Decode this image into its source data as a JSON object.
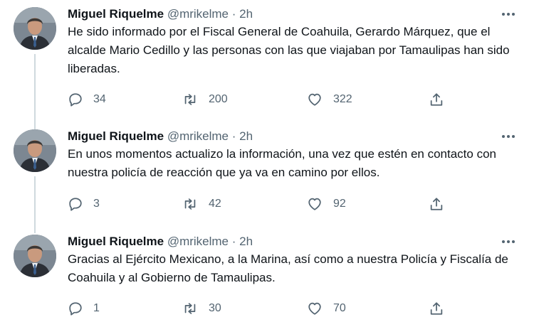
{
  "tweets": [
    {
      "name": "Miguel Riquelme",
      "handle": "@mrikelme",
      "separator": "·",
      "time": "2h",
      "text": "He sido informado por el Fiscal General de Coahuila, Gerardo Márquez, que el alcalde Mario Cedillo y las personas con las que viajaban por Tamaulipas han sido liberadas.",
      "replies": "34",
      "retweets": "200",
      "likes": "322"
    },
    {
      "name": "Miguel Riquelme",
      "handle": "@mrikelme",
      "separator": "·",
      "time": "2h",
      "text": "En unos momentos actualizo la información, una vez que estén en contacto con nuestra policía de reacción que ya va en camino por ellos.",
      "replies": "3",
      "retweets": "42",
      "likes": "92"
    },
    {
      "name": "Miguel Riquelme",
      "handle": "@mrikelme",
      "separator": "·",
      "time": "2h",
      "text": "Gracias al Ejército Mexicano, a la Marina, así como a nuestra Policía y Fiscalía de Coahuila y al Gobierno de Tamaulipas.",
      "replies": "1",
      "retweets": "30",
      "likes": "70"
    }
  ],
  "icons": [
    "reply-icon",
    "retweet-icon",
    "like-icon",
    "share-icon",
    "more-options-icon"
  ],
  "colors": {
    "text": "#0f1419",
    "secondary": "#536471",
    "thread_line": "#cfd9de"
  }
}
